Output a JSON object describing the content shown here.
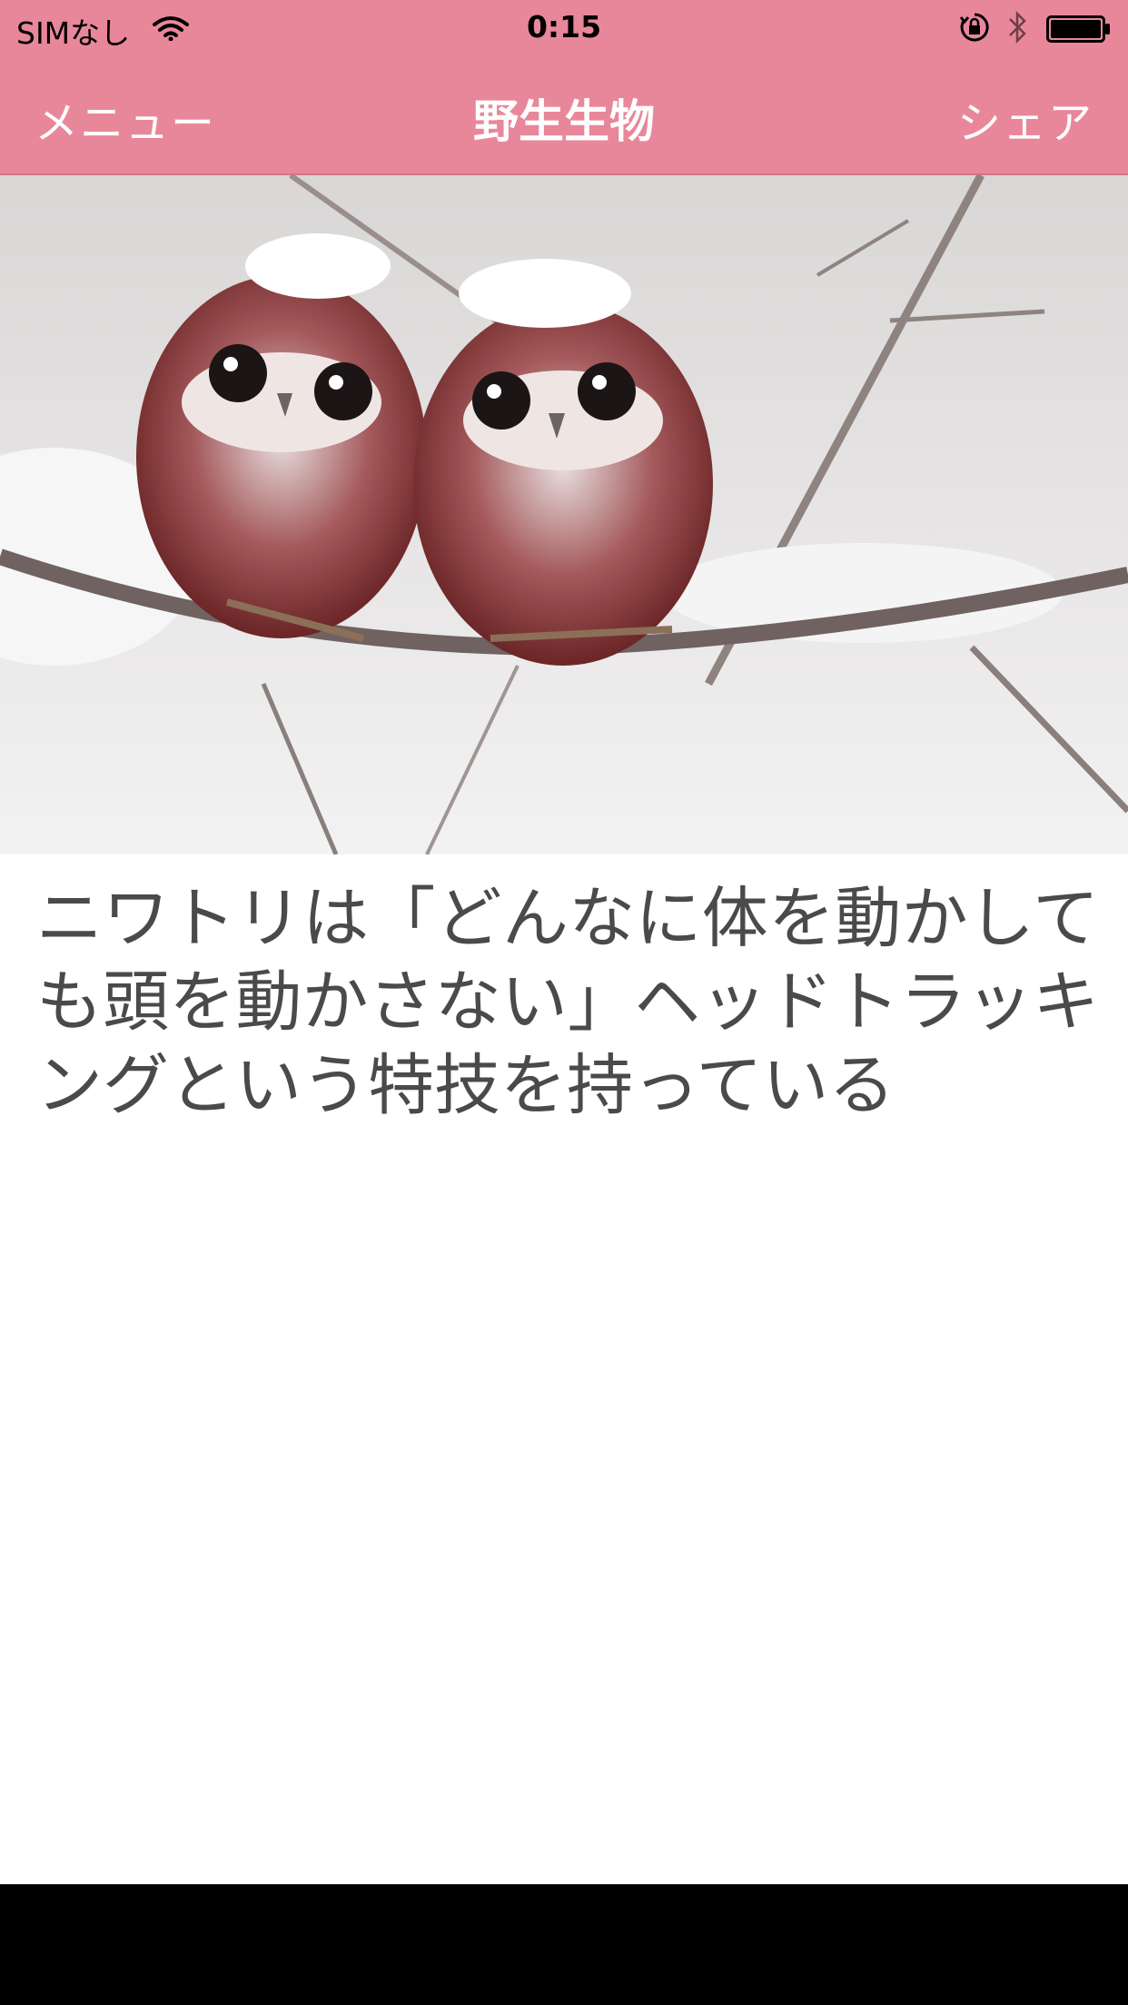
{
  "status_bar": {
    "carrier": "SIMなし",
    "time": "0:15"
  },
  "nav": {
    "left_label": "メニュー",
    "title": "野生生物",
    "right_label": "シェア"
  },
  "article": {
    "image_label": "two owls on a snowy branch",
    "text": "ニワトリは「どんなに体を動かしても頭を動かさない」ヘッドトラッキングという特技を持っている"
  },
  "colors": {
    "bar_background": "#e9879a",
    "bar_text": "#ffffff",
    "body_text": "#4a4a4a",
    "bottom": "#000000"
  },
  "icons": [
    "wifi-icon",
    "rotation-lock-icon",
    "bluetooth-icon",
    "battery-icon"
  ]
}
